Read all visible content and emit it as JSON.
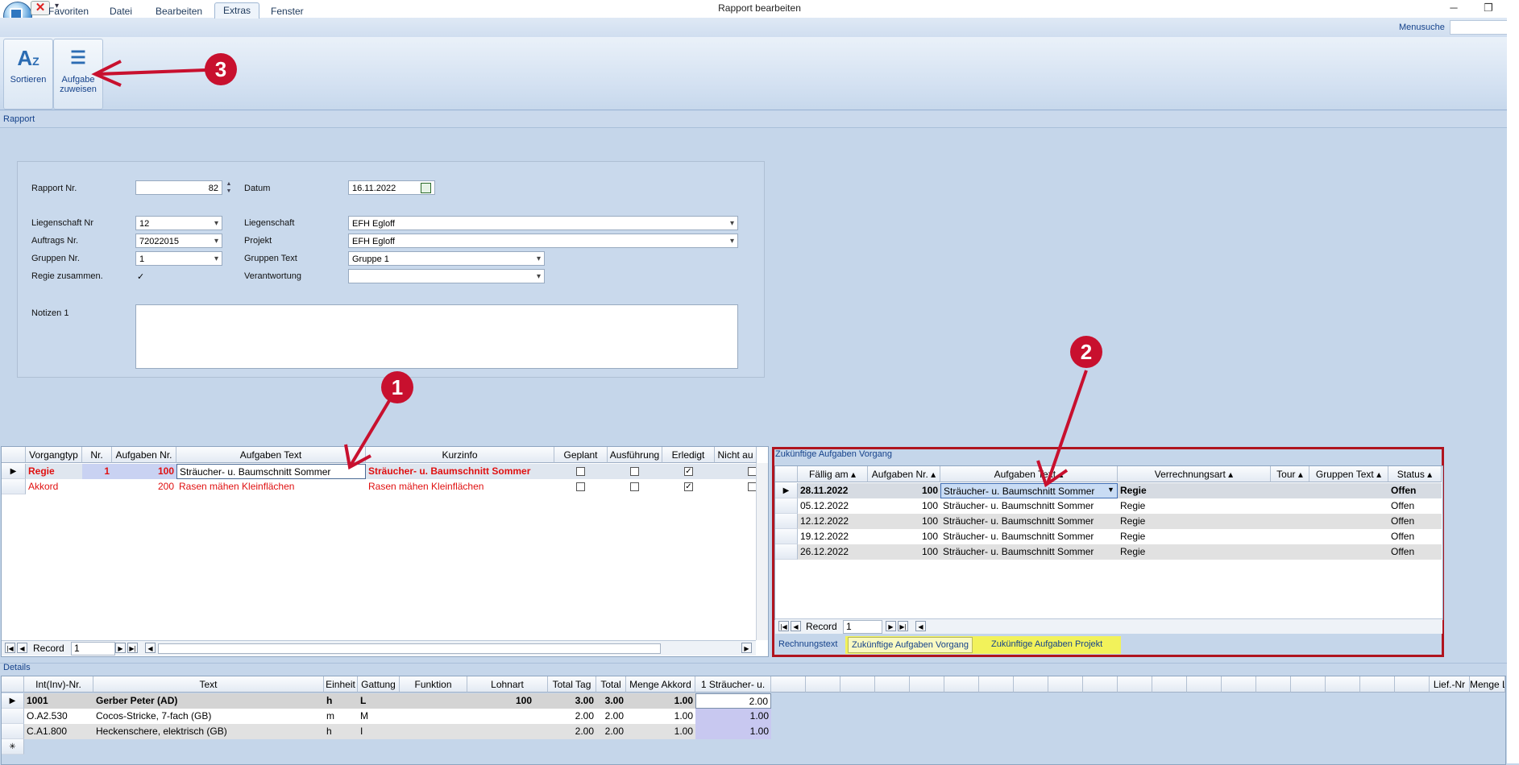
{
  "window": {
    "title": "Rapport bearbeiten",
    "minimize": "─",
    "restore": "❐"
  },
  "ribbon": {
    "tabs": [
      "Favoriten",
      "Datei",
      "Bearbeiten",
      "Extras",
      "Fenster"
    ],
    "active_tab": "Extras",
    "menusuche_label": "Menusuche",
    "buttons": [
      {
        "label1": "Sortieren",
        "label2": ""
      },
      {
        "label1": "Aufgabe",
        "label2": "zuweisen"
      }
    ]
  },
  "sections": {
    "rapport": "Rapport",
    "details": "Details"
  },
  "form": {
    "rapport_nr_label": "Rapport Nr.",
    "rapport_nr": "82",
    "datum_label": "Datum",
    "datum": "16.11.2022",
    "liegenschaft_nr_label": "Liegenschaft Nr",
    "liegenschaft_nr": "12",
    "liegenschaft_label": "Liegenschaft",
    "liegenschaft": "EFH Egloff",
    "auftrags_nr_label": "Auftrags Nr.",
    "auftrags_nr": "72022015",
    "projekt_label": "Projekt",
    "projekt": "EFH Egloff",
    "gruppen_nr_label": "Gruppen Nr.",
    "gruppen_nr": "1",
    "gruppen_text_label": "Gruppen Text",
    "gruppen_text": "Gruppe 1",
    "regie_label": "Regie zusammen.",
    "regie_checked": "✓",
    "verantwortung_label": "Verantwortung",
    "verantwortung": "",
    "notizen_label": "Notizen 1",
    "notizen": ""
  },
  "left_grid": {
    "headers": [
      "Vorgangtyp",
      "Nr.",
      "Aufgaben Nr.",
      "Aufgaben Text",
      "Kurzinfo",
      "Geplant",
      "Ausführung",
      "Erledigt",
      "Nicht au"
    ],
    "rows": [
      {
        "typ": "Regie",
        "nr": "1",
        "anr": "100",
        "text": "Sträucher- u. Baumschnitt Sommer",
        "kurz": "Sträucher- u. Baumschnitt Sommer",
        "erledigt": "✓"
      },
      {
        "typ": "Akkord",
        "nr": "",
        "anr": "200",
        "text": "Rasen mähen Kleinflächen",
        "kurz": "Rasen mähen Kleinflächen",
        "erledigt": "✓"
      }
    ],
    "record_label": "Record",
    "record_value": "1"
  },
  "right_panel": {
    "title": "Zukünftige Aufgaben Vorgang",
    "headers": [
      "Fällig am",
      "Aufgaben Nr.",
      "Aufgaben Text",
      "Verrechnungsart",
      "Tour",
      "Gruppen Text",
      "Status"
    ],
    "rows": [
      {
        "date": "28.11.2022",
        "nr": "100",
        "text": "Sträucher- u. Baumschnitt Sommer",
        "art": "Regie",
        "status": "Offen"
      },
      {
        "date": "05.12.2022",
        "nr": "100",
        "text": "Sträucher- u. Baumschnitt Sommer",
        "art": "Regie",
        "status": "Offen"
      },
      {
        "date": "12.12.2022",
        "nr": "100",
        "text": "Sträucher- u. Baumschnitt Sommer",
        "art": "Regie",
        "status": "Offen"
      },
      {
        "date": "19.12.2022",
        "nr": "100",
        "text": "Sträucher- u. Baumschnitt Sommer",
        "art": "Regie",
        "status": "Offen"
      },
      {
        "date": "26.12.2022",
        "nr": "100",
        "text": "Sträucher- u. Baumschnitt Sommer",
        "art": "Regie",
        "status": "Offen"
      }
    ],
    "record_label": "Record",
    "record_value": "1",
    "tabs": [
      "Rechnungstext",
      "Zukünftige Aufgaben Vorgang",
      "Zukünftige Aufgaben Projekt"
    ]
  },
  "details_grid": {
    "headers": [
      "Int(Inv)-Nr.",
      "Text",
      "Einheit",
      "Gattung",
      "Funktion",
      "Lohnart",
      "Total Tag",
      "Total",
      "Menge Akkord",
      "1 Sträucher- u.",
      "Lief.-Nr",
      "Menge L"
    ],
    "rows": [
      {
        "nr": "1001",
        "text": "Gerber Peter (AD)",
        "einheit": "h",
        "gattung": "L",
        "lohnart": "100",
        "tag": "3.00",
        "total": "3.00",
        "menge": "1.00",
        "str": "2.00"
      },
      {
        "nr": "O.A2.530",
        "text": "Cocos-Stricke, 7-fach (GB)",
        "einheit": "m",
        "gattung": "M",
        "lohnart": "",
        "tag": "2.00",
        "total": "2.00",
        "menge": "1.00",
        "str": "1.00"
      },
      {
        "nr": "C.A1.800",
        "text": "Heckenschere, elektrisch (GB)",
        "einheit": "h",
        "gattung": "I",
        "lohnart": "",
        "tag": "2.00",
        "total": "2.00",
        "menge": "1.00",
        "str": "1.00"
      }
    ],
    "new_row_marker": "✳"
  },
  "annotations": [
    "1",
    "2",
    "3"
  ],
  "colors": {
    "annotation_red": "#c8102e",
    "highlight_yellow": "#f2f25a",
    "text_red": "#e01010"
  }
}
